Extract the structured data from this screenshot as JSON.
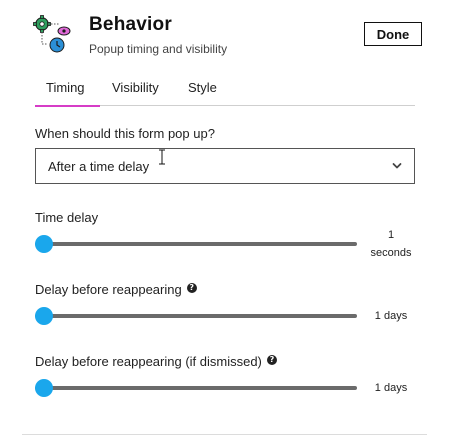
{
  "header": {
    "icon": "behavior-flow-icon",
    "title": "Behavior",
    "subtitle": "Popup timing and visibility",
    "done_label": "Done"
  },
  "tabs": [
    {
      "label": "Timing",
      "active": true
    },
    {
      "label": "Visibility",
      "active": false
    },
    {
      "label": "Style",
      "active": false
    }
  ],
  "form": {
    "popup_question": "When should this form pop up?",
    "popup_trigger": {
      "selected": "After a time delay",
      "icon": "chevron-down-icon"
    },
    "time_delay": {
      "label": "Time delay",
      "value": 1,
      "value_text": "1",
      "unit": "seconds",
      "slider_fraction": 0
    },
    "reappear_delay": {
      "label": "Delay before reappearing",
      "value_text": "1 days",
      "help_icon": "help-icon",
      "slider_fraction": 0
    },
    "reappear_dismissed": {
      "label": "Delay before reappearing (if dismissed)",
      "value_text": "1 days",
      "help_icon": "help-icon",
      "slider_fraction": 0
    }
  },
  "colors": {
    "accent_tab": "#d63cc7",
    "slider_thumb": "#1aa7ec",
    "slider_track": "#6b6b6b",
    "icon_green": "#2f9e5e",
    "icon_blue": "#2b8fd6",
    "icon_pink": "#e06ad8"
  }
}
